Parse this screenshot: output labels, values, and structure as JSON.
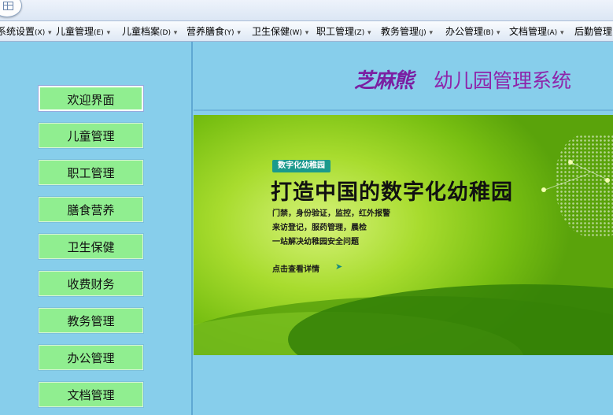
{
  "menubar": {
    "items": [
      {
        "label": "系统设置",
        "hotkey": "(X)"
      },
      {
        "label": "儿童管理",
        "hotkey": "(E)"
      },
      {
        "label": "儿童档案",
        "hotkey": "(D)"
      },
      {
        "label": "营养膳食",
        "hotkey": "(Y)"
      },
      {
        "label": "卫生保健",
        "hotkey": "(W)"
      },
      {
        "label": "职工管理",
        "hotkey": "(Z)"
      },
      {
        "label": "教务管理",
        "hotkey": "(J)"
      },
      {
        "label": "办公管理",
        "hotkey": "(B)"
      },
      {
        "label": "文档管理",
        "hotkey": "(A)"
      },
      {
        "label": "后勤管理",
        "hotkey": ""
      }
    ]
  },
  "sidebar": {
    "items": [
      {
        "label": "欢迎界面"
      },
      {
        "label": "儿童管理"
      },
      {
        "label": "职工管理"
      },
      {
        "label": "膳食营养"
      },
      {
        "label": "卫生保健"
      },
      {
        "label": "收费财务"
      },
      {
        "label": "教务管理"
      },
      {
        "label": "办公管理"
      },
      {
        "label": "文档管理"
      }
    ]
  },
  "header": {
    "brand": "芝麻熊",
    "title": "幼儿园管理系统"
  },
  "banner": {
    "badge": "数字化幼稚园",
    "headline": "打造中国的数字化幼稚园",
    "lines": [
      "门禁，身份验证，监控，红外报警",
      "来访登记，服药管理，晨检",
      "一站解决幼稚园安全问题"
    ],
    "link": "点击查看详情",
    "link_arrow": "➤"
  },
  "colors": {
    "background": "#87ceeb",
    "nav_button": "#90ee90",
    "title_purple": "#8e24aa"
  }
}
